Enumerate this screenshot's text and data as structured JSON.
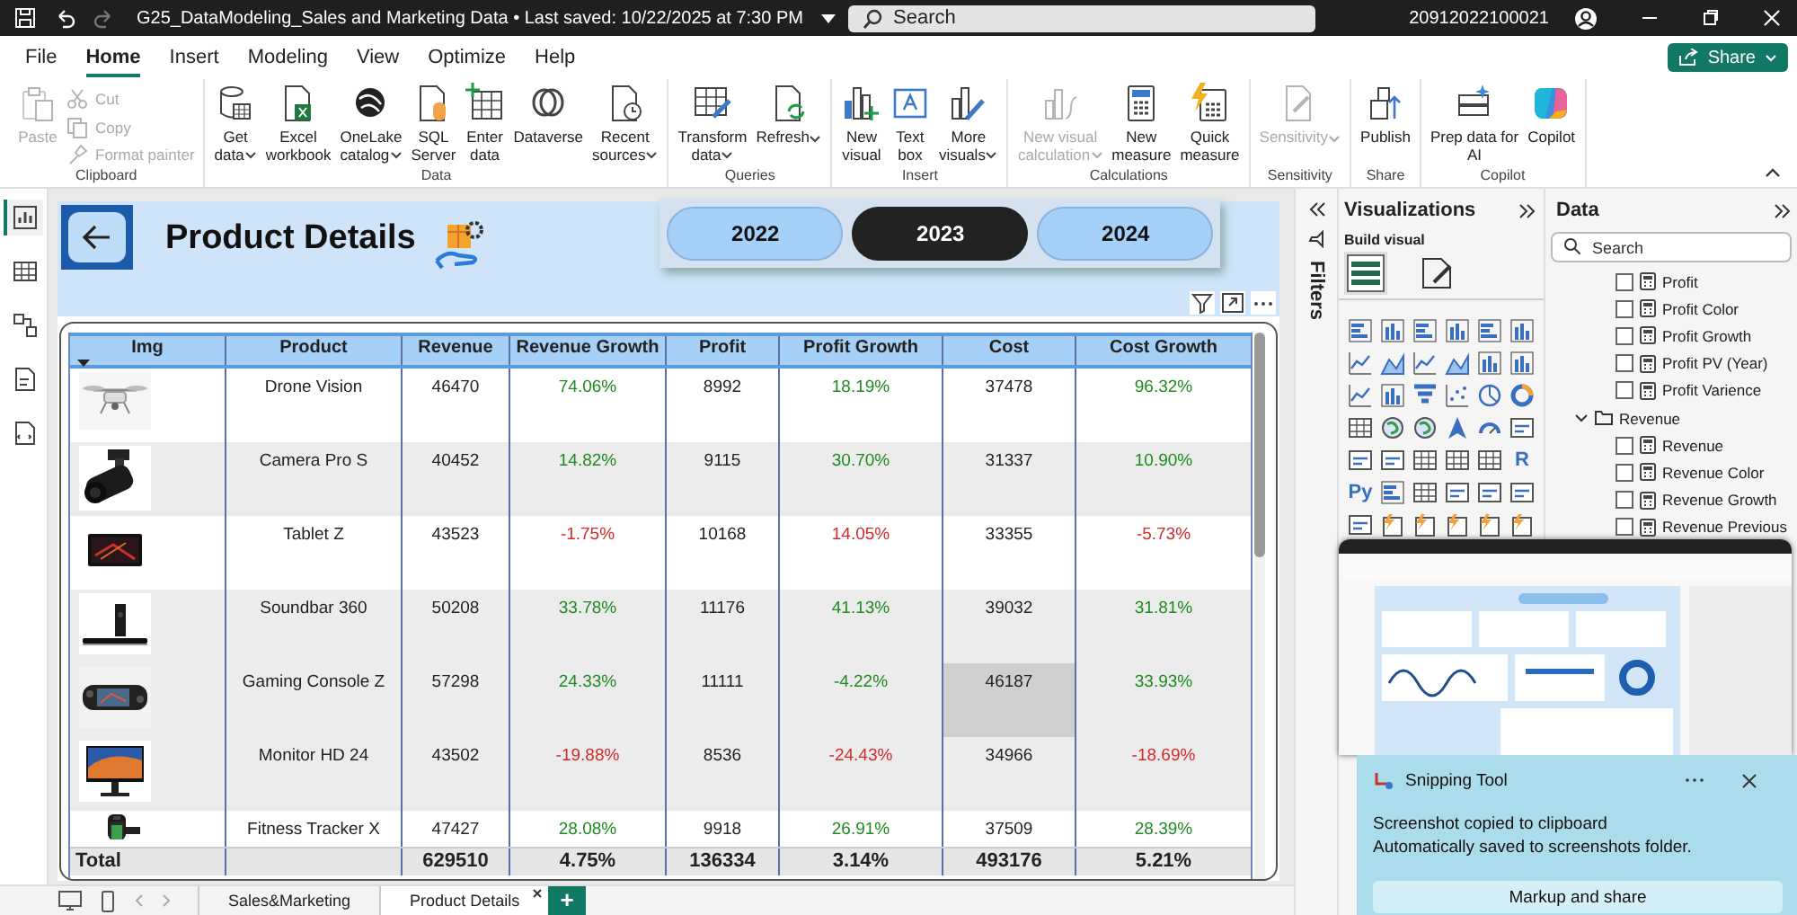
{
  "title_bar": {
    "title": "G25_DataModeling_Sales and Marketing Data • Last saved: 10/22/2025 at 7:30 PM",
    "undo": {
      "disabled": false
    },
    "redo": {
      "disabled": true
    },
    "search": {
      "placeholder": "Search"
    },
    "user": "20912022100021"
  },
  "menu_tabs": [
    {
      "label": "File",
      "selected": false
    },
    {
      "label": "Home",
      "selected": true
    },
    {
      "label": "Insert",
      "selected": false
    },
    {
      "label": "Modeling",
      "selected": false
    },
    {
      "label": "View",
      "selected": false
    },
    {
      "label": "Optimize",
      "selected": false
    },
    {
      "label": "Help",
      "selected": false
    }
  ],
  "share_button": {
    "label": "Share"
  },
  "ribbon": {
    "groups": [
      {
        "label": "Clipboard",
        "buttons": [
          {
            "kind": "large",
            "label": "Paste",
            "disabled": true,
            "dropdown": false
          },
          {
            "kind": "small",
            "label": "Cut",
            "disabled": true,
            "dropdown": false
          },
          {
            "kind": "small",
            "label": "Copy",
            "disabled": true,
            "dropdown": false
          },
          {
            "kind": "small",
            "label": "Format painter",
            "disabled": true,
            "dropdown": false
          }
        ]
      },
      {
        "label": "Data",
        "buttons": [
          {
            "kind": "large",
            "label": "Get\ndata",
            "disabled": false,
            "dropdown": true
          },
          {
            "kind": "large",
            "label": "Excel\nworkbook",
            "disabled": false,
            "dropdown": false
          },
          {
            "kind": "large",
            "label": "OneLake\ncatalog",
            "disabled": false,
            "dropdown": true
          },
          {
            "kind": "large",
            "label": "SQL\nServer",
            "disabled": false,
            "dropdown": false
          },
          {
            "kind": "large",
            "label": "Enter\ndata",
            "disabled": false,
            "dropdown": false
          },
          {
            "kind": "large",
            "label": "Dataverse",
            "disabled": false,
            "dropdown": false
          },
          {
            "kind": "large",
            "label": "Recent\nsources",
            "disabled": false,
            "dropdown": true
          }
        ]
      },
      {
        "label": "Queries",
        "buttons": [
          {
            "kind": "large",
            "label": "Transform\ndata",
            "disabled": false,
            "dropdown": true
          },
          {
            "kind": "large",
            "label": "Refresh",
            "disabled": false,
            "dropdown": true
          }
        ]
      },
      {
        "label": "Insert",
        "buttons": [
          {
            "kind": "large",
            "label": "New\nvisual",
            "disabled": false,
            "dropdown": false
          },
          {
            "kind": "large",
            "label": "Text\nbox",
            "disabled": false,
            "dropdown": false
          },
          {
            "kind": "large",
            "label": "More\nvisuals",
            "disabled": false,
            "dropdown": true
          }
        ]
      },
      {
        "label": "Calculations",
        "buttons": [
          {
            "kind": "large",
            "label": "New visual\ncalculation",
            "disabled": true,
            "dropdown": true
          },
          {
            "kind": "large",
            "label": "New\nmeasure",
            "disabled": false,
            "dropdown": false
          },
          {
            "kind": "large",
            "label": "Quick\nmeasure",
            "disabled": false,
            "dropdown": false
          }
        ]
      },
      {
        "label": "Sensitivity",
        "buttons": [
          {
            "kind": "large",
            "label": "Sensitivity",
            "disabled": true,
            "dropdown": true
          }
        ]
      },
      {
        "label": "Share",
        "buttons": [
          {
            "kind": "large",
            "label": "Publish",
            "disabled": false,
            "dropdown": false
          }
        ]
      },
      {
        "label": "Copilot",
        "buttons": [
          {
            "kind": "large",
            "label": "Prep data for\nAI",
            "disabled": false,
            "dropdown": false
          },
          {
            "kind": "large",
            "label": "Copilot",
            "disabled": false,
            "dropdown": false
          }
        ]
      }
    ]
  },
  "view_rail": [
    {
      "selected": true
    },
    {
      "selected": false
    },
    {
      "selected": false
    },
    {
      "selected": false
    },
    {
      "selected": false
    }
  ],
  "report": {
    "title": "Product Details",
    "years": [
      {
        "label": "2022",
        "selected": false
      },
      {
        "label": "2023",
        "selected": true
      },
      {
        "label": "2024",
        "selected": false
      }
    ],
    "table": {
      "columns": [
        "Img",
        "Product",
        "Revenue",
        "Revenue Growth",
        "Profit",
        "Profit Growth",
        "Cost",
        "Cost Growth"
      ],
      "rows": [
        {
          "product": "Drone Vision",
          "revenue": "46470",
          "revenue_growth": {
            "value": "74.06%",
            "color": "#1f8a1f"
          },
          "profit": "8992",
          "profit_growth": {
            "value": "18.19%",
            "color": "#1f8a1f"
          },
          "cost": "37478",
          "cost_highlighted": false,
          "cost_growth": {
            "value": "96.32%",
            "color": "#1f8a1f"
          },
          "shaded": false
        },
        {
          "product": "Camera Pro S",
          "revenue": "40452",
          "revenue_growth": {
            "value": "14.82%",
            "color": "#1f8a1f"
          },
          "profit": "9115",
          "profit_growth": {
            "value": "30.70%",
            "color": "#1f8a1f"
          },
          "cost": "31337",
          "cost_highlighted": false,
          "cost_growth": {
            "value": "10.90%",
            "color": "#1f8a1f"
          },
          "shaded": true
        },
        {
          "product": "Tablet Z",
          "revenue": "43523",
          "revenue_growth": {
            "value": "-1.75%",
            "color": "#d42a2a"
          },
          "profit": "10168",
          "profit_growth": {
            "value": "14.05%",
            "color": "#d42a2a"
          },
          "cost": "33355",
          "cost_highlighted": false,
          "cost_growth": {
            "value": "-5.73%",
            "color": "#d42a2a"
          },
          "shaded": false
        },
        {
          "product": "Soundbar 360",
          "revenue": "50208",
          "revenue_growth": {
            "value": "33.78%",
            "color": "#1f8a1f"
          },
          "profit": "11176",
          "profit_growth": {
            "value": "41.13%",
            "color": "#1f8a1f"
          },
          "cost": "39032",
          "cost_highlighted": false,
          "cost_growth": {
            "value": "31.81%",
            "color": "#1f8a1f"
          },
          "shaded": true
        },
        {
          "product": "Gaming Console Z",
          "revenue": "57298",
          "revenue_growth": {
            "value": "24.33%",
            "color": "#1f8a1f"
          },
          "profit": "11111",
          "profit_growth": {
            "value": "-4.22%",
            "color": "#1f8a1f"
          },
          "cost": "46187",
          "cost_highlighted": true,
          "cost_growth": {
            "value": "33.93%",
            "color": "#1f8a1f"
          },
          "shaded": true
        },
        {
          "product": "Monitor HD 24",
          "revenue": "43502",
          "revenue_growth": {
            "value": "-19.88%",
            "color": "#d42a2a"
          },
          "profit": "8536",
          "profit_growth": {
            "value": "-24.43%",
            "color": "#d42a2a"
          },
          "cost": "34966",
          "cost_highlighted": false,
          "cost_growth": {
            "value": "-18.69%",
            "color": "#d42a2a"
          },
          "shaded": true
        },
        {
          "product": "Fitness Tracker X",
          "revenue": "47427",
          "revenue_growth": {
            "value": "28.08%",
            "color": "#1f8a1f"
          },
          "profit": "9918",
          "profit_growth": {
            "value": "26.91%",
            "color": "#1f8a1f"
          },
          "cost": "37509",
          "cost_highlighted": false,
          "cost_growth": {
            "value": "28.39%",
            "color": "#1f8a1f"
          },
          "shaded": false
        }
      ],
      "total": {
        "label": "Total",
        "revenue": "629510",
        "revenue_growth": "4.75%",
        "profit": "136334",
        "profit_growth": "3.14%",
        "cost": "493176",
        "cost_growth": "5.21%"
      }
    }
  },
  "page_tabs": [
    {
      "label": "Sales&Marketing",
      "selected": false
    },
    {
      "label": "Product Details",
      "selected": true
    }
  ],
  "add_page": {
    "label": "+"
  },
  "filters_pane": {
    "title": "Filters"
  },
  "visualizations_pane": {
    "title": "Visualizations",
    "subtitle": "Build visual",
    "tabs": [
      {
        "selected": true
      },
      {
        "selected": false
      }
    ],
    "gallery": [
      {
        "kind": "icon"
      },
      {
        "kind": "icon"
      },
      {
        "kind": "icon"
      },
      {
        "kind": "icon"
      },
      {
        "kind": "icon"
      },
      {
        "kind": "icon"
      },
      {
        "kind": "icon"
      },
      {
        "kind": "icon"
      },
      {
        "kind": "icon"
      },
      {
        "kind": "icon"
      },
      {
        "kind": "icon"
      },
      {
        "kind": "icon"
      },
      {
        "kind": "icon"
      },
      {
        "kind": "icon"
      },
      {
        "kind": "icon"
      },
      {
        "kind": "icon"
      },
      {
        "kind": "icon"
      },
      {
        "kind": "icon"
      },
      {
        "kind": "icon"
      },
      {
        "kind": "icon"
      },
      {
        "kind": "icon"
      },
      {
        "kind": "icon"
      },
      {
        "kind": "icon"
      },
      {
        "kind": "icon"
      },
      {
        "kind": "icon"
      },
      {
        "kind": "icon"
      },
      {
        "kind": "icon"
      },
      {
        "kind": "icon"
      },
      {
        "kind": "icon"
      },
      {
        "kind": "text",
        "text": "R"
      },
      {
        "kind": "text",
        "text": "Py"
      },
      {
        "kind": "icon"
      },
      {
        "kind": "icon"
      },
      {
        "kind": "icon"
      },
      {
        "kind": "icon"
      },
      {
        "kind": "icon"
      },
      {
        "kind": "icon"
      },
      {
        "kind": "icon"
      },
      {
        "kind": "icon"
      },
      {
        "kind": "icon"
      },
      {
        "kind": "icon"
      },
      {
        "kind": "icon"
      }
    ]
  },
  "data_pane": {
    "title": "Data",
    "search": {
      "placeholder": "Search"
    },
    "fields": [
      {
        "kind": "measure",
        "label": "Profit",
        "checked": false
      },
      {
        "kind": "measure",
        "label": "Profit Color",
        "checked": false
      },
      {
        "kind": "measure",
        "label": "Profit Growth",
        "checked": false
      },
      {
        "kind": "measure",
        "label": "Profit PV (Year)",
        "checked": false
      },
      {
        "kind": "measure",
        "label": "Profit Varience",
        "checked": false
      },
      {
        "kind": "folder",
        "label": "Revenue",
        "expanded": true,
        "children": [
          {
            "kind": "measure",
            "label": "Revenue",
            "checked": false
          },
          {
            "kind": "measure",
            "label": "Revenue Color",
            "checked": false
          },
          {
            "kind": "measure",
            "label": "Revenue Growth",
            "checked": false
          },
          {
            "kind": "measure",
            "label": "Revenue Previous",
            "checked": false
          }
        ]
      }
    ]
  },
  "notification": {
    "app": "Snipping Tool",
    "title": "Screenshot copied to clipboard",
    "message": "Automatically saved to screenshots folder.",
    "button": "Markup and share"
  }
}
